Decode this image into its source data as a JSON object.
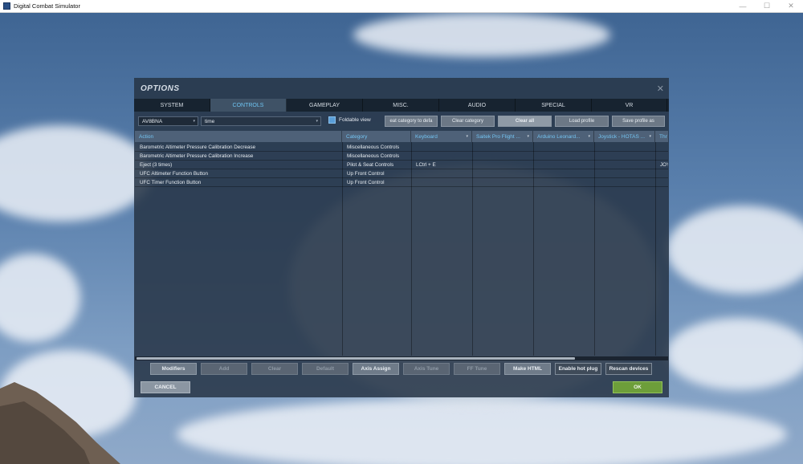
{
  "window": {
    "title": "Digital Combat Simulator",
    "minimize": "—",
    "maximize": "☐",
    "close": "✕"
  },
  "dialog": {
    "title": "OPTIONS",
    "close": "✕"
  },
  "tabs": [
    {
      "label": "SYSTEM",
      "active": false
    },
    {
      "label": "CONTROLS",
      "active": true
    },
    {
      "label": "GAMEPLAY",
      "active": false
    },
    {
      "label": "MISC.",
      "active": false
    },
    {
      "label": "AUDIO",
      "active": false
    },
    {
      "label": "SPECIAL",
      "active": false
    },
    {
      "label": "VR",
      "active": false
    }
  ],
  "toolbar": {
    "aircraft_select": "AV8BNA",
    "search_value": "time",
    "foldable_view_label": "Foldable view",
    "foldable_view_checked": true,
    "reset_category_label": "eat category to defa",
    "clear_category_label": "Clear category",
    "clear_all_label": "Clear all",
    "load_profile_label": "Load profile",
    "save_profile_label": "Save profile as"
  },
  "columns": [
    "Action",
    "Category",
    "Keyboard",
    "Saitek Pro Flight ...",
    "Arduino Leonard...",
    "Joystick - HOTAS ...",
    "Thr"
  ],
  "rows": [
    {
      "action": "Barometric Altimeter Pressure Calibration Decrease",
      "category": "Miscellaneous Controls",
      "keyboard": "",
      "joystick_extra": ""
    },
    {
      "action": "Barometric Altimeter Pressure Calibration Increase",
      "category": "Miscellaneous Controls",
      "keyboard": "",
      "joystick_extra": ""
    },
    {
      "action": "Eject (3 times)",
      "category": "Pilot & Seat Controls",
      "keyboard": "LCtrl + E",
      "joystick_extra": "JOY"
    },
    {
      "action": "UFC Altimeter Function Button",
      "category": "Up Front Control",
      "keyboard": "",
      "joystick_extra": ""
    },
    {
      "action": "UFC Timer Function Button",
      "category": "Up Front Control",
      "keyboard": "",
      "joystick_extra": ""
    }
  ],
  "bottom_buttons": {
    "modifiers": "Modifiers",
    "add": "Add",
    "clear": "Clear",
    "default": "Default",
    "axis_assign": "Axis Assign",
    "axis_tune": "Axis Tune",
    "ff_tune": "FF Tune",
    "make_html": "Make HTML",
    "hot_plug": "Enable hot plug",
    "rescan": "Rescan devices"
  },
  "footer": {
    "cancel": "CANCEL",
    "ok": "OK"
  },
  "icons": {
    "dropdown": "▾",
    "scroll_left": "◂",
    "scroll_right": "▸"
  },
  "colors": {
    "accent_tab": "#6ec3f0",
    "ok_button": "#6d9e3a",
    "checkbox": "#5a9ed8"
  }
}
